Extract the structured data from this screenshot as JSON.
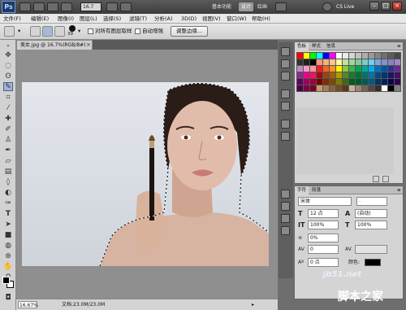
{
  "app": {
    "logo": "Ps",
    "zoom": "16.7",
    "workspaces": [
      "基本功能",
      "设计",
      "绘画"
    ],
    "cs_live": "CS Live"
  },
  "menu": [
    "文件(F)",
    "编辑(E)",
    "图像(I)",
    "图层(L)",
    "选择(S)",
    "滤镜(T)",
    "分析(A)",
    "3D(D)",
    "视图(V)",
    "窗口(W)",
    "帮助(H)"
  ],
  "options": {
    "brush_size": "39",
    "sample_all_layers": "对所有图层取样",
    "auto_enhance": "自动增强",
    "refine_edge": "调整边缘..."
  },
  "document": {
    "tab": "美女.jpg @ 16.7%(RGB/8#)",
    "close": "×"
  },
  "status": {
    "zoom": "16.67%",
    "doc": "文档:23.0M/23.0M"
  },
  "panels": {
    "swatch_tabs": [
      "色板",
      "样式",
      "信息"
    ],
    "swatch_colors": [
      "#ff0000",
      "#ffff00",
      "#00ff00",
      "#00ffff",
      "#0000ff",
      "#ff00ff",
      "#ffffff",
      "#ebebeb",
      "#d6d6d6",
      "#c2c2c2",
      "#adadad",
      "#999999",
      "#858585",
      "#707070",
      "#5c5c5c",
      "#474747",
      "#333333",
      "#1f1f1f",
      "#000000",
      "#f7977a",
      "#f9ad81",
      "#fdc68a",
      "#fff79a",
      "#c4df9b",
      "#a3d39c",
      "#82ca9d",
      "#7bcdc8",
      "#6ecff6",
      "#7ea7d8",
      "#8493ca",
      "#8882be",
      "#a187be",
      "#bc8dbf",
      "#f49ac2",
      "#f6989d",
      "#ed1c24",
      "#f26522",
      "#f7941d",
      "#fff200",
      "#8dc63f",
      "#39b54a",
      "#00a651",
      "#00a99d",
      "#00aeef",
      "#0072bc",
      "#0054a6",
      "#2e3192",
      "#662d91",
      "#92278f",
      "#ec008c",
      "#ed145b",
      "#9e0b0f",
      "#a0410d",
      "#a36209",
      "#aba000",
      "#598527",
      "#1a7b30",
      "#007236",
      "#00746b",
      "#0076a3",
      "#004b80",
      "#003471",
      "#1b1464",
      "#440e62",
      "#630460",
      "#9e005d",
      "#9e0039",
      "#790000",
      "#7b2e00",
      "#7d4900",
      "#827b00",
      "#406618",
      "#005e20",
      "#005826",
      "#005952",
      "#005b7f",
      "#003663",
      "#002157",
      "#0d004c",
      "#32004b",
      "#4b0049",
      "#7b0046",
      "#7a0026",
      "#c69c6d",
      "#a67c52",
      "#8c6239",
      "#754c24",
      "#603913",
      "#c7b299",
      "#998675",
      "#736357",
      "#534741",
      "#362f2d",
      "#ffffff",
      "#000000",
      "#808080"
    ],
    "char_tabs": [
      "字符",
      "段落"
    ],
    "font": "宋体",
    "font_style": "-",
    "size": "12 点",
    "leading": "(自动)",
    "v_scale": "100%",
    "h_scale": "100%",
    "tracking_label": "0%",
    "kerning": "0",
    "baseline": "0 点",
    "color_label": "颜色:"
  },
  "watermark": {
    "site": "jb51.net",
    "brand": "脚本之家"
  }
}
